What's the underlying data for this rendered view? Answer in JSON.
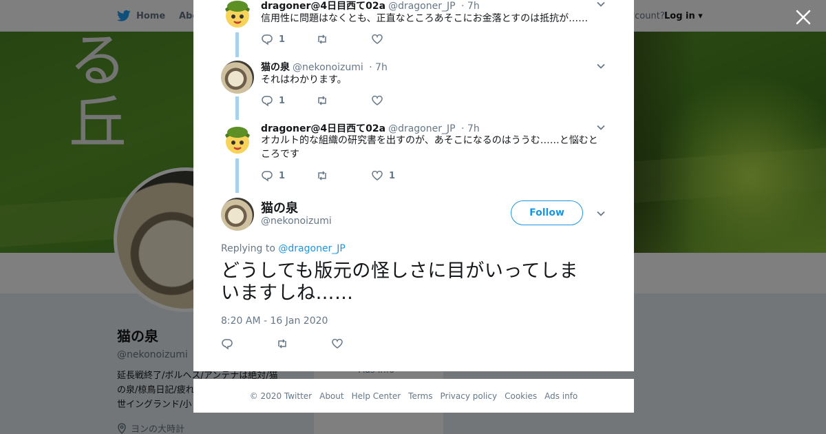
{
  "colors": {
    "accent": "#1da1f2",
    "link": "#1b95e0",
    "thread_line": "#a6d2ee",
    "muted": "#657786"
  },
  "topnav": {
    "home_label": "Home",
    "about_label": "Abo",
    "account_text": "ccount?",
    "login_label": "Log in"
  },
  "banner": {
    "glyph_1": "る",
    "glyph_2": "丘"
  },
  "profile": {
    "name": "猫の泉",
    "handle": "@nekonoizumi",
    "bio_lines": [
      "延長戦終了/ボルヘス/アンテナは絶対/猫",
      "の泉/椋鳥日記/疲れ",
      "世イングランド/小"
    ],
    "location": "ヨンの大時計",
    "mid_card_text": "Ads info"
  },
  "thread": [
    {
      "avatar_icon": "yukkuri-marisa-avatar",
      "name": "dragoner@4日目西て02a",
      "handle": "@dragoner_JP",
      "time": "· 7h",
      "text": "信用性に問題はなくとも、正直なところあそこにお金落とすのは抵抗が……",
      "reply_count": "1",
      "retweet_count": "",
      "like_count": ""
    },
    {
      "avatar_icon": "cat-painting-avatar",
      "name": "猫の泉",
      "handle": "@nekonoizumi",
      "time": "· 7h",
      "text": "それはわかります。",
      "reply_count": "1",
      "retweet_count": "",
      "like_count": ""
    },
    {
      "avatar_icon": "yukkuri-marisa-avatar",
      "name": "dragoner@4日目西て02a",
      "handle": "@dragoner_JP",
      "time": "· 7h",
      "text": "オカルト的な組織の研究書を出すのが、あそこになるのはううむ……と悩むところです",
      "reply_count": "1",
      "retweet_count": "",
      "like_count": "1"
    }
  ],
  "main_tweet": {
    "name": "猫の泉",
    "handle": "@nekonoizumi",
    "follow_label": "Follow",
    "replying_prefix": "Replying to",
    "replying_to": "@dragoner_JP",
    "text": "どうしても版元の怪しさに目がいってしまいますしね……",
    "timestamp": "8:20 AM - 16 Jan 2020"
  },
  "footer": {
    "links": [
      "© 2020 Twitter",
      "About",
      "Help Center",
      "Terms",
      "Privacy policy",
      "Cookies",
      "Ads info"
    ]
  }
}
